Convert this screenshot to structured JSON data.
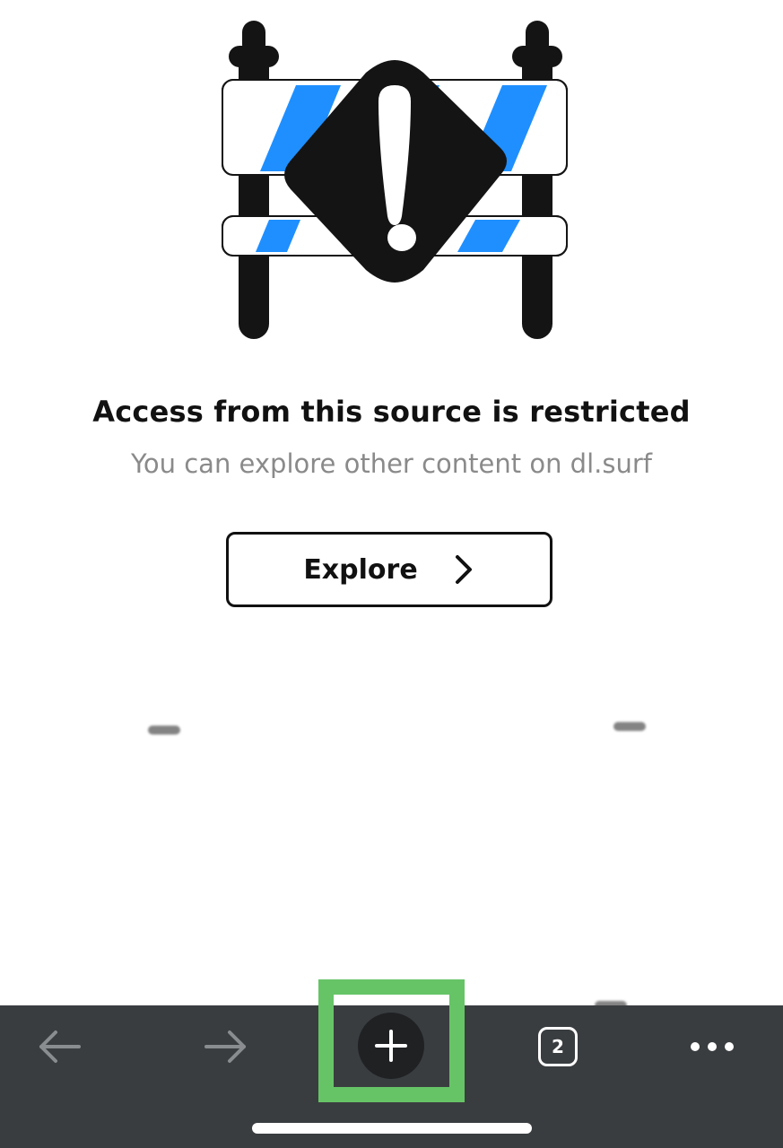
{
  "illustration": {
    "icon": "roadblock-warning-icon",
    "colors": {
      "stripe": "#1f8fff",
      "dark": "#141414"
    }
  },
  "message": {
    "title": "Access from this source is restricted",
    "subtitle": "You can explore other content on dl.surf"
  },
  "explore_button": {
    "label": "Explore",
    "icon": "chevron-right-icon"
  },
  "toolbar": {
    "background": "#3a3d40",
    "back_icon": "arrow-left-icon",
    "forward_icon": "arrow-right-icon",
    "new_tab_icon": "plus-icon",
    "tab_count": "2",
    "menu_icon": "more-dots-icon"
  },
  "highlight": {
    "color": "#66c467",
    "target": "new-tab-button"
  }
}
